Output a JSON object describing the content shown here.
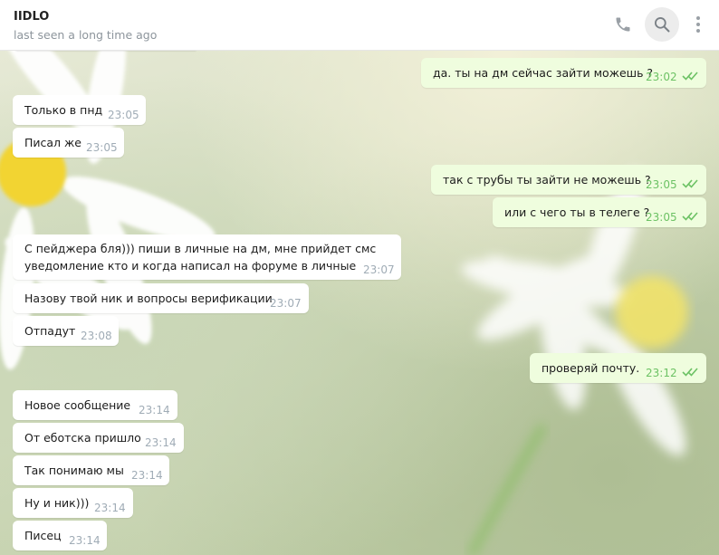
{
  "chat": {
    "title": "IIDLO",
    "status": "last seen a long time ago"
  },
  "header_icons": [
    "phone-icon",
    "search-icon",
    "more-vertical-icon"
  ],
  "colors": {
    "incoming_bubble": "#ffffff",
    "outgoing_bubble": "#effdde",
    "outgoing_time": "#6cc264",
    "read_ticks": "#6cc264"
  },
  "messages": [
    {
      "direction": "out",
      "text": "да. ты на дм сейчас зайти можешь ?",
      "time": "23:02",
      "read": true
    },
    {
      "direction": "in",
      "text": "Только в пнд",
      "time": "23:05"
    },
    {
      "direction": "in",
      "text": "Писал же",
      "time": "23:05"
    },
    {
      "direction": "out",
      "text": "так с трубы ты зайти не можешь ?",
      "time": "23:05",
      "read": true
    },
    {
      "direction": "out",
      "text": "или с чего ты в телеге ?",
      "time": "23:05",
      "read": true
    },
    {
      "direction": "in",
      "text_lines": [
        "С пейджера бля))) пиши в личные на дм, мне прийдет смс",
        "уведомление кто и когда написал на форуме в личные"
      ],
      "time": "23:07"
    },
    {
      "direction": "in",
      "text": "Назову твой ник и вопросы верификации",
      "time": "23:07"
    },
    {
      "direction": "in",
      "text": "Отпадут",
      "time": "23:08"
    },
    {
      "direction": "out",
      "text": "проверяй почту.",
      "time": "23:12",
      "read": true
    },
    {
      "direction": "in",
      "text": "Новое сообщение",
      "time": "23:14"
    },
    {
      "direction": "in",
      "text": "От еботска пришло",
      "time": "23:14"
    },
    {
      "direction": "in",
      "text": "Так понимаю мы",
      "time": "23:14"
    },
    {
      "direction": "in",
      "text": "Ну и ник)))",
      "time": "23:14"
    },
    {
      "direction": "in",
      "text": "Писец",
      "time": "23:14"
    }
  ]
}
